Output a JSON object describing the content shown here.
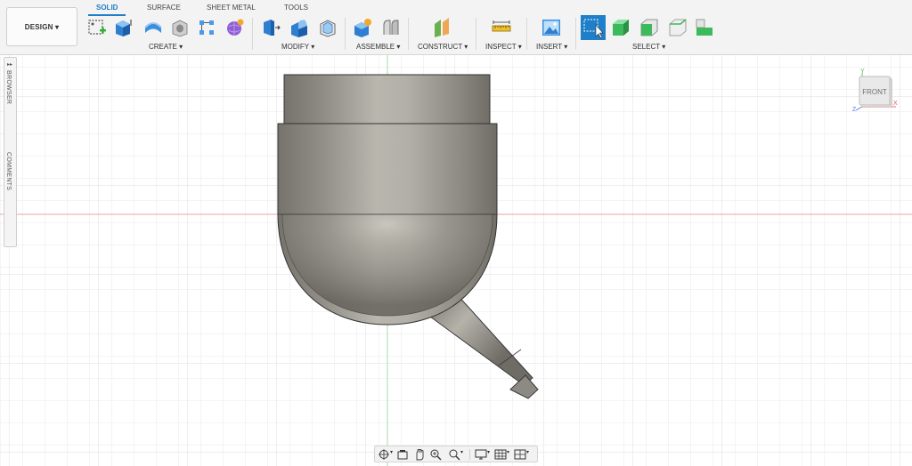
{
  "workspace": {
    "label": "DESIGN ▾"
  },
  "tabs": [
    {
      "label": "SOLID",
      "active": true
    },
    {
      "label": "SURFACE"
    },
    {
      "label": "SHEET METAL"
    },
    {
      "label": "TOOLS"
    }
  ],
  "groups": {
    "create": "CREATE ▾",
    "modify": "MODIFY ▾",
    "assemble": "ASSEMBLE ▾",
    "construct": "CONSTRUCT ▾",
    "inspect": "INSPECT ▾",
    "insert": "INSERT ▾",
    "select": "SELECT ▾"
  },
  "side_panel": {
    "browser": "BROWSER",
    "comments": "COMMENTS"
  },
  "viewcube": {
    "face": "FRONT",
    "axis_y": "Y",
    "axis_x": "X",
    "axis_z": "Z"
  },
  "colors": {
    "accent": "#1f7fc8",
    "x_axis": "#e8a0a0",
    "y_axis": "#9fd69f",
    "grid": "#e6e6e6"
  },
  "icons": {
    "create": [
      "sketch-icon",
      "extrude-icon",
      "revolve-icon",
      "hole-icon",
      "pattern-icon",
      "form-icon"
    ],
    "modify": [
      "press-pull-icon",
      "fillet-icon",
      "shell-icon"
    ],
    "assemble": [
      "new-component-icon",
      "joint-icon"
    ],
    "construct": [
      "plane-icon"
    ],
    "inspect": [
      "measure-icon"
    ],
    "insert": [
      "insert-image-icon"
    ],
    "select": [
      "select-window-icon",
      "select-body-icon",
      "select-face-icon",
      "select-edge-icon",
      "select-priority-icon"
    ],
    "navigation": [
      "orbit-icon",
      "look-at-icon",
      "pan-icon",
      "zoom-fit-icon",
      "zoom-icon",
      "display-settings-icon",
      "grid-settings-icon",
      "viewports-icon"
    ]
  }
}
